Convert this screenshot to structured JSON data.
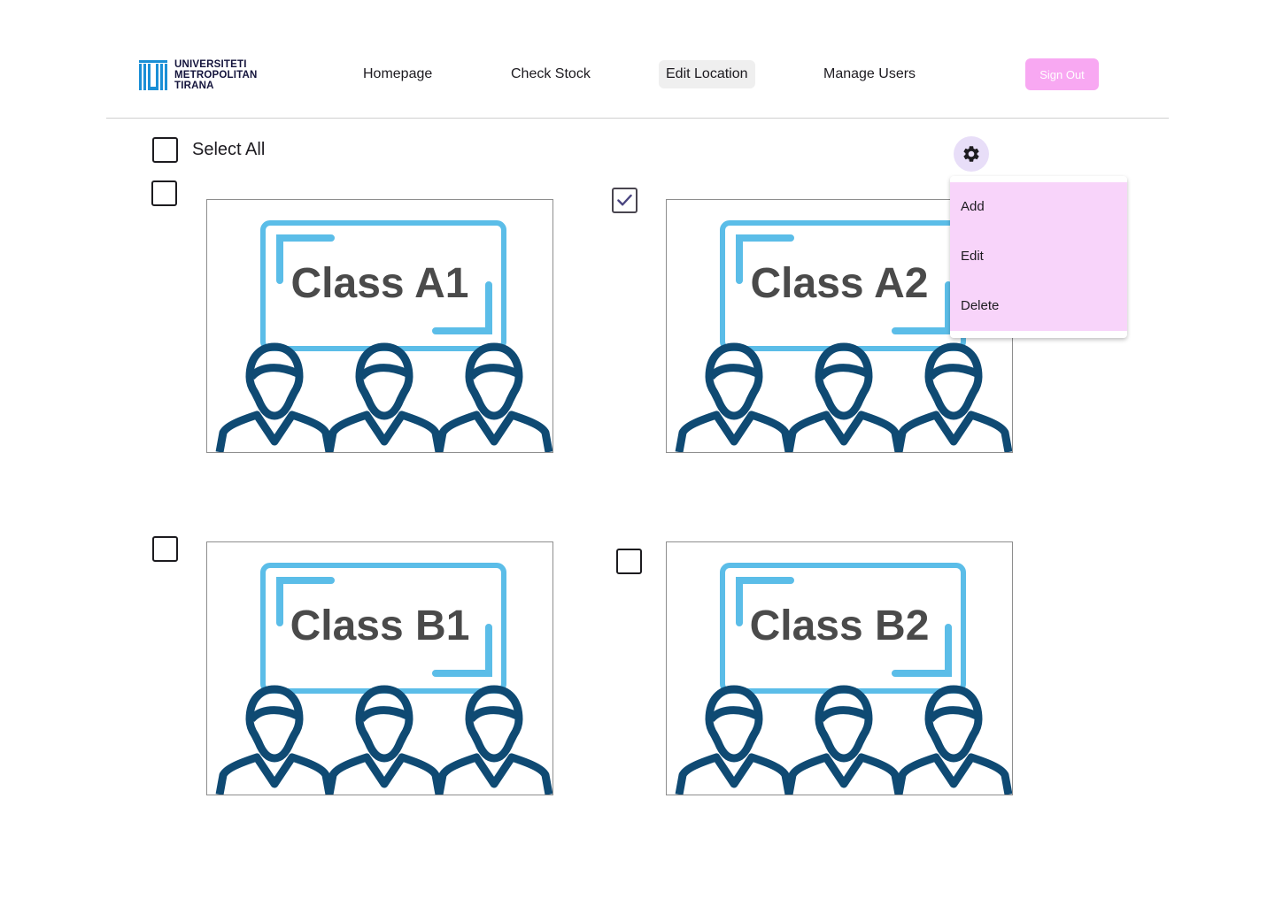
{
  "brand": {
    "logo_lines": [
      "UNIVERSITETI",
      "METROPOLITAN",
      "TIRANA"
    ],
    "accent": "#1a8fd6"
  },
  "nav": {
    "items": [
      {
        "label": "Homepage"
      },
      {
        "label": "Check Stock"
      },
      {
        "label": "Edit Location",
        "active": true
      },
      {
        "label": "Manage Users"
      }
    ],
    "signout_label": "Sign Out"
  },
  "toolbar": {
    "select_all_label": "Select All",
    "select_all_checked": false,
    "settings_icon": "gear-icon"
  },
  "menu": {
    "items": [
      {
        "label": "Add"
      },
      {
        "label": "Edit"
      },
      {
        "label": "Delete"
      }
    ]
  },
  "classrooms": [
    {
      "title": "Class A1",
      "checked": false
    },
    {
      "title": "Class A2",
      "checked": true
    },
    {
      "title": "Class B1",
      "checked": false
    },
    {
      "title": "Class B2",
      "checked": false
    }
  ],
  "colors": {
    "board": "#5bbde8",
    "people": "#0f4a73",
    "signout": "#f8a8f2",
    "menu_bg": "#f8d4fa",
    "gear_bg": "#e8def8"
  }
}
